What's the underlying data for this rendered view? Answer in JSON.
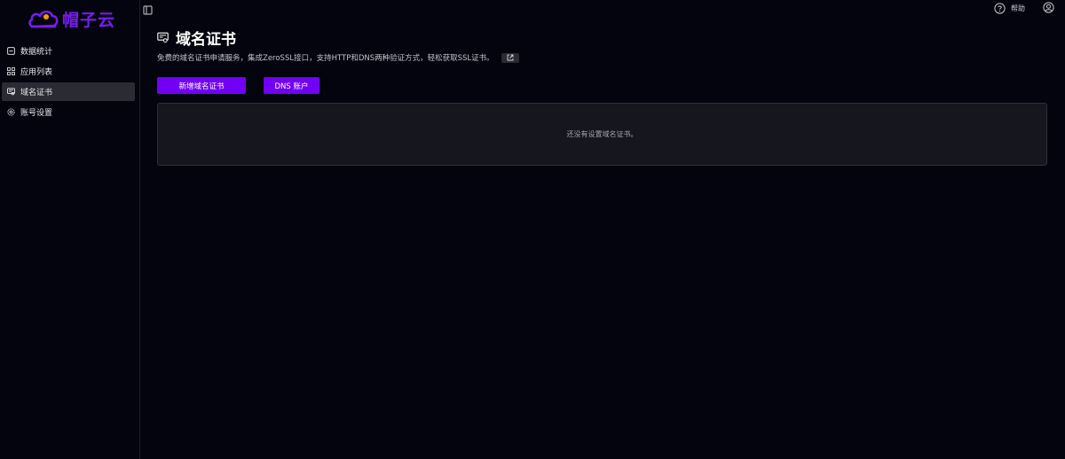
{
  "brand": {
    "name": "帽子云",
    "color": "#7a1cf0"
  },
  "sidebar": {
    "items": [
      {
        "label": "数据统计",
        "icon": "dashboard-icon",
        "active": false
      },
      {
        "label": "应用列表",
        "icon": "apps-icon",
        "active": false
      },
      {
        "label": "域名证书",
        "icon": "certificate-icon",
        "active": true
      },
      {
        "label": "账号设置",
        "icon": "gear-icon",
        "active": false
      }
    ]
  },
  "topbar": {
    "help_label": "帮助",
    "help_icon": "question-circle-icon",
    "user_icon": "user-circle-icon"
  },
  "main": {
    "title": "域名证书",
    "title_icon": "certificate-icon",
    "description": "免费的域名证书申请服务，集成ZeroSSL接口，支持HTTP和DNS两种验证方式，轻松获取SSL证书。",
    "buttons": {
      "add_label": "新增域名证书",
      "dns_label": "DNS 账户"
    },
    "empty_text": "还没有设置域名证书。"
  },
  "colors": {
    "background": "#03040e",
    "accent": "#7200f5",
    "panel": "#15161e",
    "active_nav": "#2a2b33"
  }
}
